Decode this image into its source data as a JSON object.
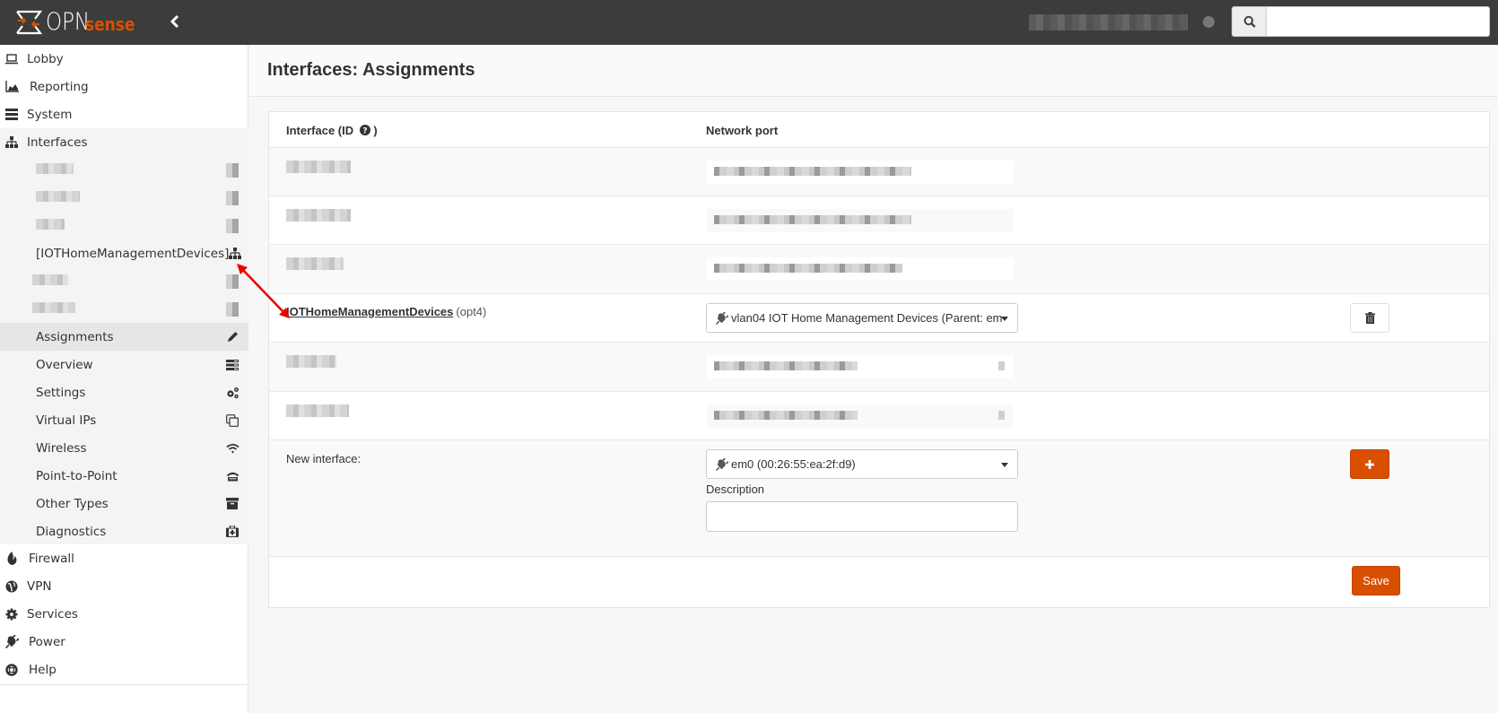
{
  "topbar": {
    "logo_text": "OPN",
    "logo_sense": "sense",
    "collapse_icon": "chevron-left-icon",
    "search_placeholder": "",
    "search_value": ""
  },
  "sidebar": {
    "top_items": [
      {
        "label": "Lobby",
        "icon": "laptop-icon"
      },
      {
        "label": "Reporting",
        "icon": "area-chart-icon"
      },
      {
        "label": "System",
        "icon": "server-icon"
      },
      {
        "label": "Interfaces",
        "icon": "sitemap-icon"
      }
    ],
    "interfaces_sub": [
      {
        "label": "[IOTHomeManagementDevices]",
        "icon": "sitemap-icon"
      },
      {
        "label": "Assignments",
        "icon": "pencil-icon",
        "active": true
      },
      {
        "label": "Overview",
        "icon": "tasks-icon"
      },
      {
        "label": "Settings",
        "icon": "cogs-icon"
      },
      {
        "label": "Virtual IPs",
        "icon": "clone-icon"
      },
      {
        "label": "Wireless",
        "icon": "wifi-icon"
      },
      {
        "label": "Point-to-Point",
        "icon": "phone-icon"
      },
      {
        "label": "Other Types",
        "icon": "archive-icon"
      },
      {
        "label": "Diagnostics",
        "icon": "medkit-icon"
      }
    ],
    "bottom_items": [
      {
        "label": "Firewall",
        "icon": "fire-icon"
      },
      {
        "label": "VPN",
        "icon": "globe-icon"
      },
      {
        "label": "Services",
        "icon": "cog-icon"
      },
      {
        "label": "Power",
        "icon": "plug-icon"
      },
      {
        "label": "Help",
        "icon": "life-ring-icon"
      }
    ]
  },
  "main": {
    "page_title": "Interfaces: Assignments",
    "table": {
      "col_interface": "Interface (ID",
      "col_interface_end": ")",
      "col_network_port": "Network port",
      "assigned_row": {
        "name": "IOTHomeManagementDevices",
        "id": "(opt4)",
        "network_port": "vlan04 IOT Home Management Devices (Parent: em"
      },
      "new_interface": {
        "label": "New interface:",
        "network_port": "em0 (00:26:55:ea:2f:d9)",
        "description_label": "Description",
        "description_value": ""
      },
      "save_label": "Save"
    }
  },
  "colors": {
    "accent": "#d94f00",
    "topbar": "#3c3c3b"
  }
}
